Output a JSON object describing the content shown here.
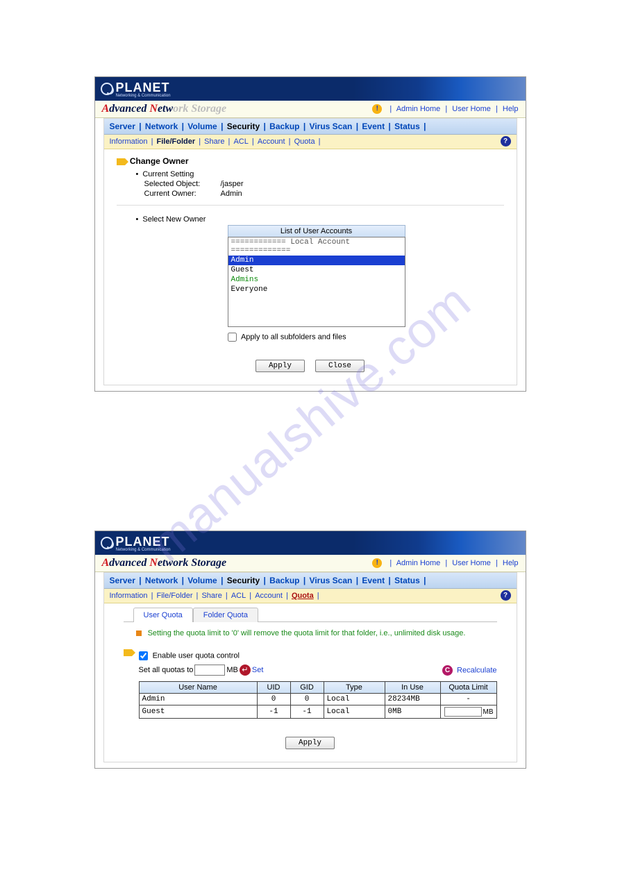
{
  "watermark": "manualshive.com",
  "shared": {
    "brand": "PLANET",
    "brand_sub": "Networking & Communication",
    "title_prefix_a": "A",
    "title_word1": "dvanced",
    "title_prefix_n": "N",
    "title_word2": "etw",
    "title_shadow": "ork Storage",
    "title_word2_full": "etwork Storage",
    "links": {
      "admin": "Admin Home",
      "user": "User Home",
      "help": "Help"
    },
    "main_tabs": [
      "Server",
      "Network",
      "Volume",
      "Security",
      "Backup",
      "Virus Scan",
      "Event",
      "Status"
    ],
    "sub_tabs": [
      "Information",
      "File/Folder",
      "Share",
      "ACL",
      "Account",
      "Quota"
    ]
  },
  "s1": {
    "active_main": "Security",
    "active_sub": "File/Folder",
    "section_title": "Change Owner",
    "current_setting": "Current Setting",
    "selected_obj_label": "Selected Object:",
    "selected_obj_value": "/jasper",
    "current_owner_label": "Current Owner:",
    "current_owner_value": "Admin",
    "select_new": "Select New Owner",
    "list_title": "List of User Accounts",
    "list_header": "============ Local Account =============",
    "accounts": [
      {
        "name": "Admin",
        "selected": true,
        "cls": ""
      },
      {
        "name": "Guest",
        "selected": false,
        "cls": ""
      },
      {
        "name": "Admins",
        "selected": false,
        "cls": "green"
      },
      {
        "name": "Everyone",
        "selected": false,
        "cls": ""
      }
    ],
    "apply_all": "Apply to all subfolders and files",
    "btn_apply": "Apply",
    "btn_close": "Close"
  },
  "s2": {
    "active_main": "Security",
    "active_sub": "Quota",
    "subtabs": {
      "user": "User Quota",
      "folder": "Folder Quota"
    },
    "note": "Setting the quota limit to '0' will remove the quota limit for that folder, i.e., unlimited disk usage.",
    "enable": "Enable user quota control",
    "setall_label": "Set all quotas to",
    "setall_unit": "MB",
    "setall_action": "Set",
    "recalc": "Recalculate",
    "cols": {
      "user": "User Name",
      "uid": "UID",
      "gid": "GID",
      "type": "Type",
      "inuse": "In Use",
      "limit": "Quota Limit"
    },
    "rows": [
      {
        "user": "Admin",
        "uid": "0",
        "gid": "0",
        "type": "Local",
        "inuse": "28234MB",
        "limit": "-",
        "editable": false
      },
      {
        "user": "Guest",
        "uid": "-1",
        "gid": "-1",
        "type": "Local",
        "inuse": "0MB",
        "limit": "",
        "limit_unit": "MB",
        "editable": true
      }
    ],
    "btn_apply": "Apply"
  }
}
